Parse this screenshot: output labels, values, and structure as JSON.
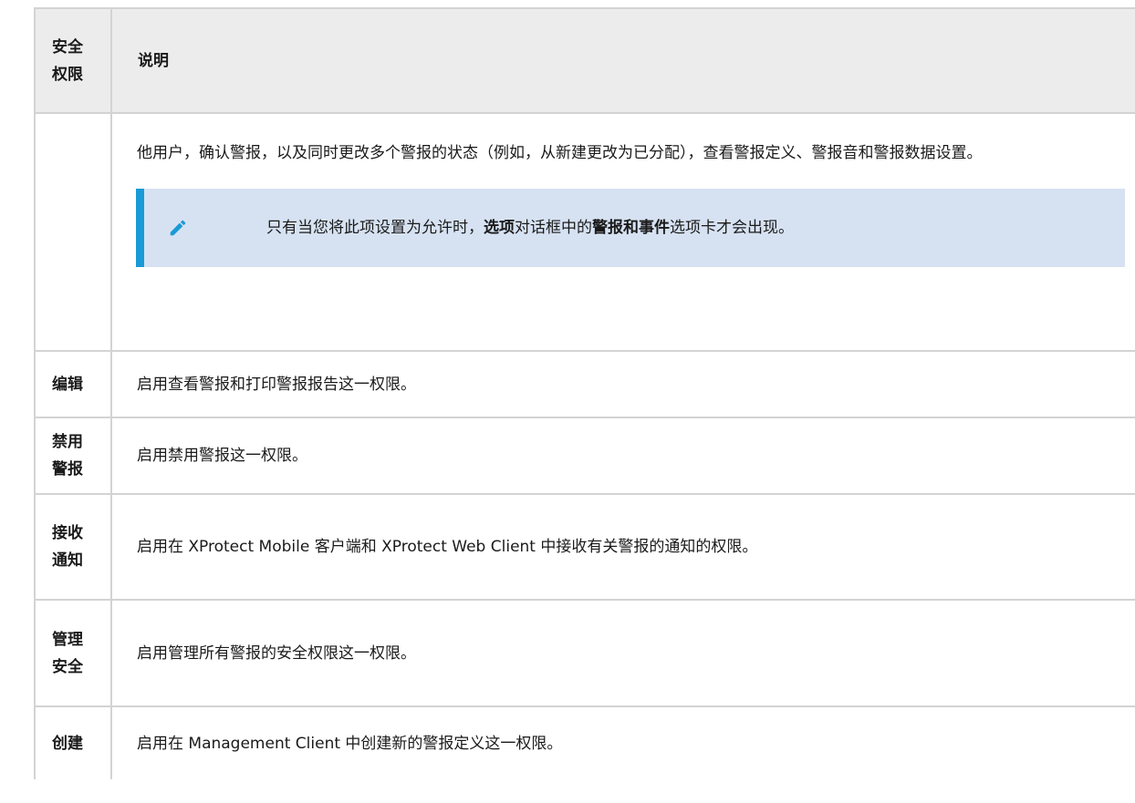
{
  "table": {
    "header": {
      "col1": "安全权限",
      "col2": "说明"
    },
    "continuation": {
      "text": "他用户，确认警报，以及同时更改多个警报的状态（例如，从新建更改为已分配），查看警报定义、警报音和警报数据设置。",
      "note": {
        "icon": "pencil-icon",
        "part1": "只有当您将此项设置为允许时，",
        "bold1": "选项",
        "part2": "对话框中的",
        "bold2": "警报和事件",
        "part3": "选项卡才会出现。"
      }
    },
    "rows": [
      {
        "permission": "编辑",
        "description": "启用查看警报和打印警报报告这一权限。"
      },
      {
        "permission": "禁用警报",
        "description": "启用禁用警报这一权限。"
      },
      {
        "permission": "接收通知",
        "description": "启用在 XProtect Mobile 客户端和 XProtect Web Client 中接收有关警报的通知的权限。"
      },
      {
        "permission": "管理安全",
        "description": "启用管理所有警报的安全权限这一权限。"
      },
      {
        "permission": "创建",
        "description": "启用在 Management Client 中创建新的警报定义这一权限。"
      }
    ]
  },
  "colors": {
    "header_bg": "#ececec",
    "border": "#d3d3d3",
    "note_bg": "#d6e2f2",
    "note_accent": "#1a9ad6"
  }
}
